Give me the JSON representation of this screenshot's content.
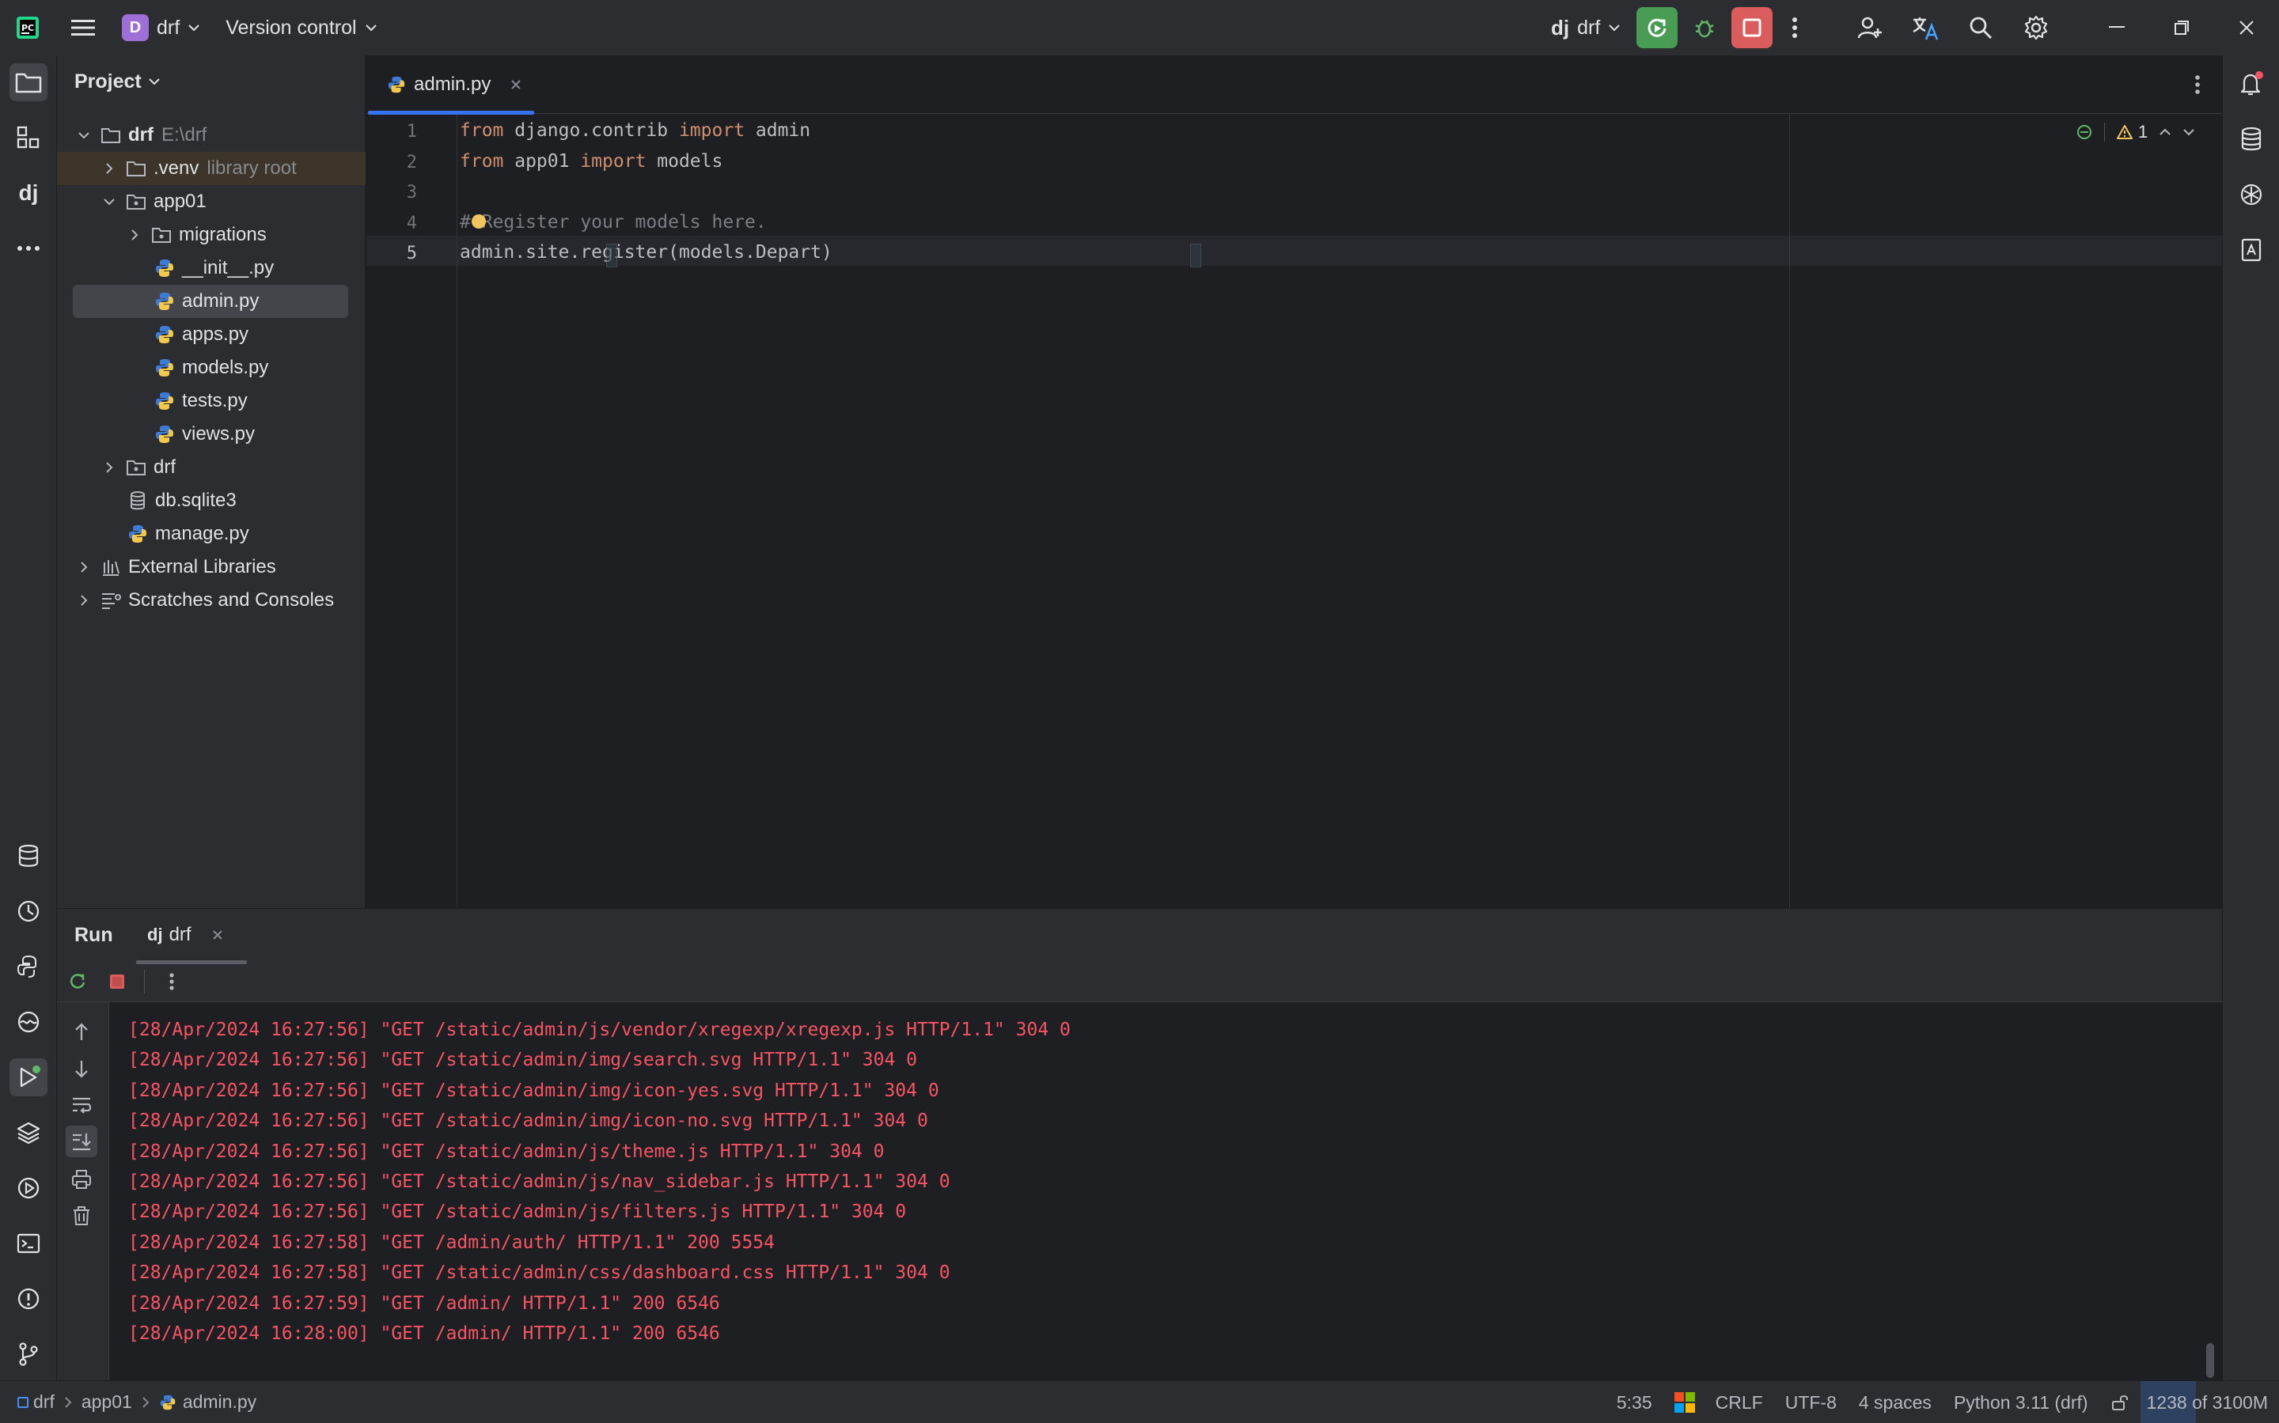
{
  "titlebar": {
    "project_badge": "D",
    "project_name": "drf",
    "vcs_label": "Version control",
    "run_config_name": "drf"
  },
  "project_panel": {
    "title": "Project",
    "tree": [
      {
        "label": "drf",
        "hint": "E:\\drf"
      },
      {
        "label": ".venv",
        "hint": "library root"
      },
      {
        "label": "app01"
      },
      {
        "label": "migrations"
      },
      {
        "label": "__init__.py"
      },
      {
        "label": "admin.py"
      },
      {
        "label": "apps.py"
      },
      {
        "label": "models.py"
      },
      {
        "label": "tests.py"
      },
      {
        "label": "views.py"
      },
      {
        "label": "drf"
      },
      {
        "label": "db.sqlite3"
      },
      {
        "label": "manage.py"
      },
      {
        "label": "External Libraries"
      },
      {
        "label": "Scratches and Consoles"
      }
    ]
  },
  "editor": {
    "tab_label": "admin.py",
    "warning_count": "1",
    "line_numbers": [
      "1",
      "2",
      "3",
      "4",
      "5"
    ],
    "code": {
      "l1_kw1": "from",
      "l1_mod": " django.contrib ",
      "l1_kw2": "import",
      "l1_name": " admin",
      "l2_kw1": "from",
      "l2_mod": " app01 ",
      "l2_kw2": "import",
      "l2_name": " models",
      "l4_comment": "# Register your models here.",
      "l5": "admin.site.register(models.Depart)"
    }
  },
  "run_panel": {
    "title": "Run",
    "tab_label": "drf",
    "log": [
      "[28/Apr/2024 16:27:56] \"GET /static/admin/js/vendor/xregexp/xregexp.js HTTP/1.1\" 304 0",
      "[28/Apr/2024 16:27:56] \"GET /static/admin/img/search.svg HTTP/1.1\" 304 0",
      "[28/Apr/2024 16:27:56] \"GET /static/admin/img/icon-yes.svg HTTP/1.1\" 304 0",
      "[28/Apr/2024 16:27:56] \"GET /static/admin/img/icon-no.svg HTTP/1.1\" 304 0",
      "[28/Apr/2024 16:27:56] \"GET /static/admin/js/theme.js HTTP/1.1\" 304 0",
      "[28/Apr/2024 16:27:56] \"GET /static/admin/js/nav_sidebar.js HTTP/1.1\" 304 0",
      "[28/Apr/2024 16:27:56] \"GET /static/admin/js/filters.js HTTP/1.1\" 304 0",
      "[28/Apr/2024 16:27:58] \"GET /admin/auth/ HTTP/1.1\" 200 5554",
      "[28/Apr/2024 16:27:58] \"GET /static/admin/css/dashboard.css HTTP/1.1\" 304 0",
      "[28/Apr/2024 16:27:59] \"GET /admin/ HTTP/1.1\" 200 6546",
      "[28/Apr/2024 16:28:00] \"GET /admin/ HTTP/1.1\" 200 6546"
    ]
  },
  "statusbar": {
    "breadcrumb": [
      "drf",
      "app01",
      "admin.py"
    ],
    "caret": "5:35",
    "line_sep": "CRLF",
    "encoding": "UTF-8",
    "indent": "4 spaces",
    "interpreter": "Python 3.11 (drf)",
    "memory": "1238 of 3100M"
  },
  "colors": {
    "accent": "#3574f0",
    "run_green": "#499c54",
    "stop_red": "#db5c5c",
    "log_red": "#f75464",
    "keyword": "#cf8e6d"
  }
}
